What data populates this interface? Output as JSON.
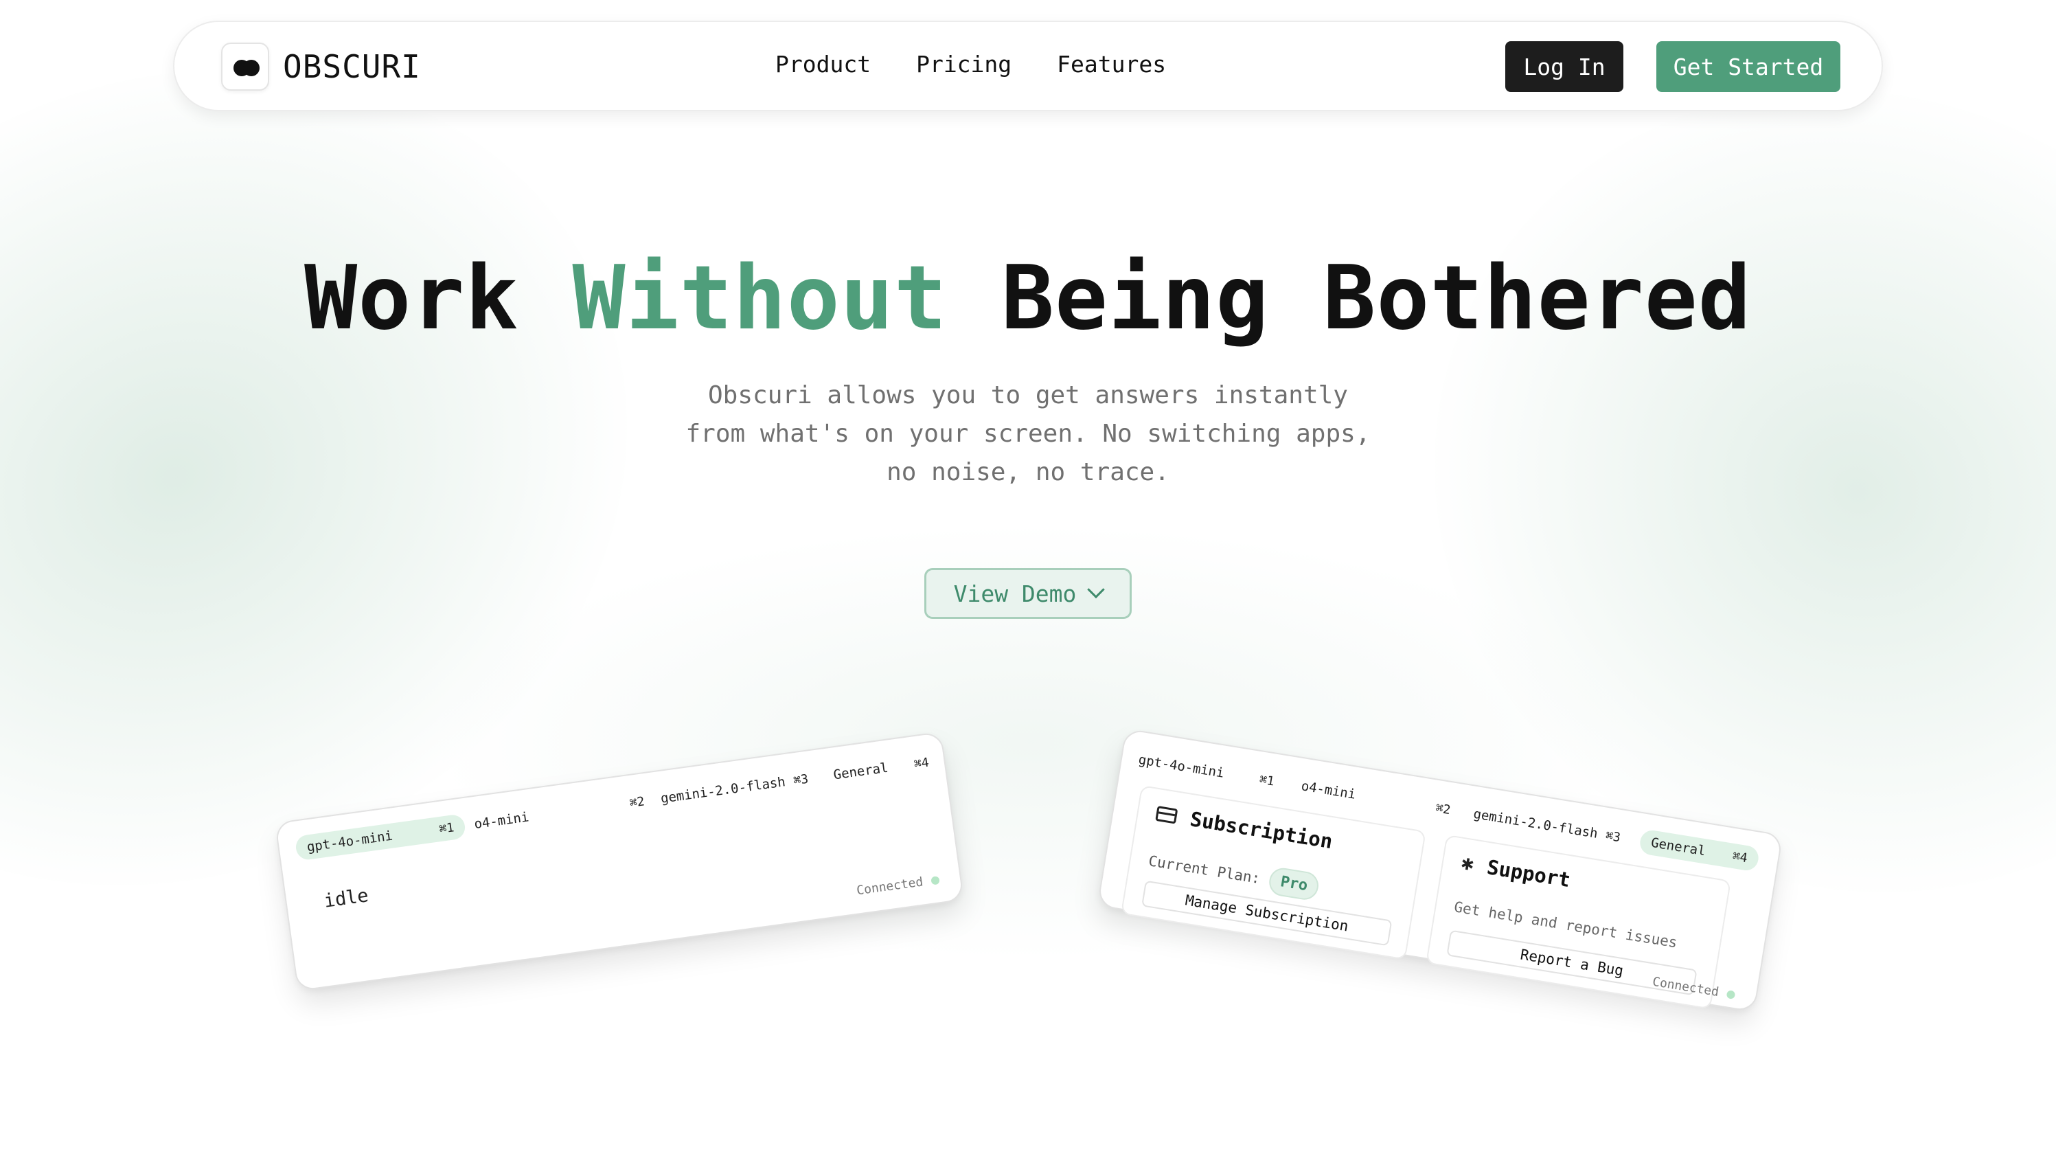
{
  "brand": {
    "name": "OBSCURI",
    "logo_icon": "two-dots-logo"
  },
  "nav": {
    "links": [
      "Product",
      "Pricing",
      "Features"
    ],
    "login_label": "Log In",
    "cta_label": "Get Started"
  },
  "hero": {
    "title_part1": "Work",
    "title_accent": "Without",
    "title_part2": "Being Bothered",
    "subtitle_line1": "Obscuri allows you to get answers instantly",
    "subtitle_line2": "from what's on your screen. No switching apps,",
    "subtitle_line3": "no noise, no trace.",
    "demo_label": "View Demo"
  },
  "colors": {
    "accent": "#4f9e7b",
    "dark": "#1d1d1d",
    "demo_bg": "#e9f3ee"
  },
  "demo_left": {
    "tabs": [
      {
        "label": "gpt-4o-mini",
        "shortcut": "⌘1",
        "active": true
      },
      {
        "label": "o4-mini",
        "shortcut": "⌘2",
        "active": false
      },
      {
        "label": "gemini-2.0-flash",
        "shortcut": "⌘3",
        "active": false
      },
      {
        "label": "General",
        "shortcut": "⌘4",
        "active": false
      }
    ],
    "body_text": "idle",
    "status": "Connected"
  },
  "demo_right": {
    "tabs": [
      {
        "label": "gpt-4o-mini",
        "shortcut": "⌘1",
        "active": false
      },
      {
        "label": "o4-mini",
        "shortcut": "⌘2",
        "active": false
      },
      {
        "label": "gemini-2.0-flash",
        "shortcut": "⌘3",
        "active": false
      },
      {
        "label": "General",
        "shortcut": "⌘4",
        "active": true
      }
    ],
    "subscription": {
      "title": "Subscription",
      "plan_label": "Current Plan:",
      "plan_value": "Pro",
      "button": "Manage Subscription"
    },
    "support": {
      "title": "Support",
      "description": "Get help and report issues",
      "button": "Report a Bug"
    },
    "status": "Connected"
  }
}
